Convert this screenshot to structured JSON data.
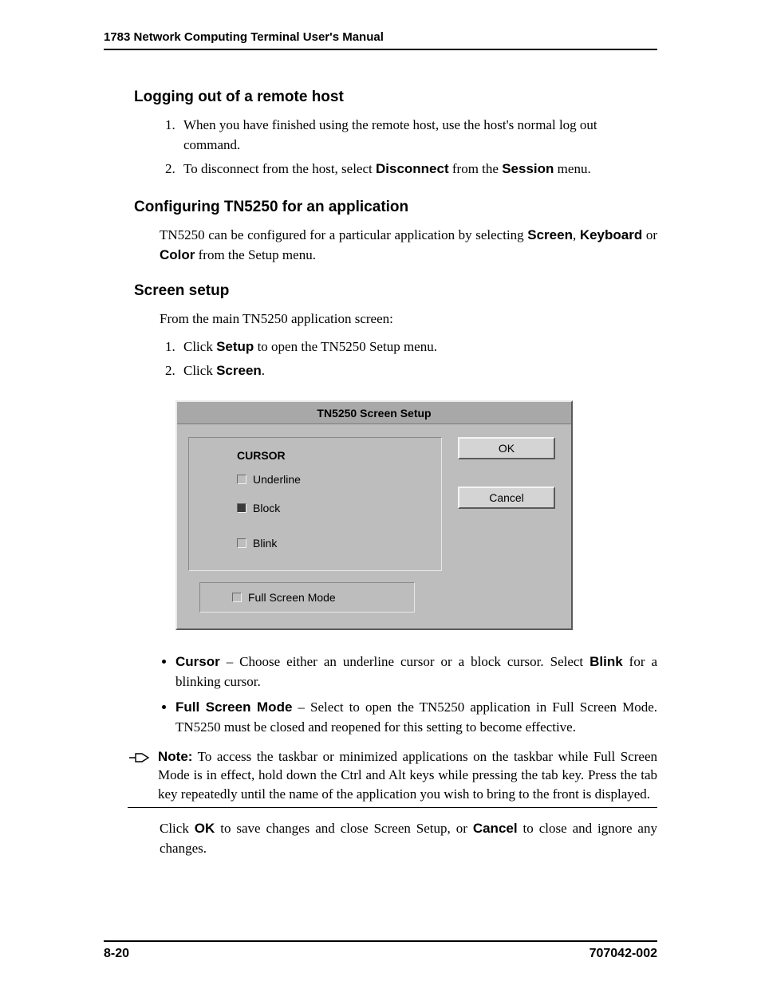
{
  "header": {
    "title": "1783 Network Computing Terminal User's Manual"
  },
  "sections": {
    "logout": {
      "heading": "Logging out of a remote host",
      "step1": "When you have finished using the remote host, use the host's normal log out command.",
      "step2_a": "To disconnect from the host, select ",
      "step2_b": "Disconnect",
      "step2_c": " from the ",
      "step2_d": "Session",
      "step2_e": " menu."
    },
    "config": {
      "heading": "Configuring TN5250 for an application",
      "para_a": "TN5250 can be configured for a particular application by selecting ",
      "para_b": "Screen",
      "para_c": ", ",
      "para_d": "Keyboard",
      "para_e": " or ",
      "para_f": "Color",
      "para_g": " from the Setup menu."
    },
    "screensetup": {
      "heading": "Screen setup",
      "intro": "From the main TN5250 application screen:",
      "step1_a": "Click ",
      "step1_b": "Setup",
      "step1_c": " to open the TN5250 Setup menu.",
      "step2_a": "Click ",
      "step2_b": "Screen",
      "step2_c": "."
    },
    "dialog": {
      "title": "TN5250 Screen Setup",
      "group_title": "CURSOR",
      "opt_underline": "Underline",
      "opt_block": "Block",
      "opt_blink": "Blink",
      "opt_fullscreen": "Full Screen Mode",
      "btn_ok": "OK",
      "btn_cancel": "Cancel"
    },
    "bullets": {
      "b1_a": "Cursor",
      "b1_b": " – Choose either an underline cursor or a block cursor. Select ",
      "b1_c": "Blink",
      "b1_d": " for a blinking cursor.",
      "b2_a": "Full Screen Mode",
      "b2_b": " – Select to open the TN5250 application in Full Screen Mode. TN5250 must be closed and reopened for this setting to become effective."
    },
    "note": {
      "label": "Note:",
      "text": " To access the taskbar or minimized applications on the taskbar while Full Screen Mode is in effect, hold down the Ctrl and Alt keys while pressing the tab key. Press the tab key repeatedly until the name of the application you wish to bring to the front is displayed."
    },
    "closing": {
      "a": "Click ",
      "b": "OK",
      "c": " to save changes and close Screen Setup, or ",
      "d": "Cancel",
      "e": " to close and ignore any changes."
    }
  },
  "footer": {
    "page": "8-20",
    "doc": "707042-002"
  }
}
